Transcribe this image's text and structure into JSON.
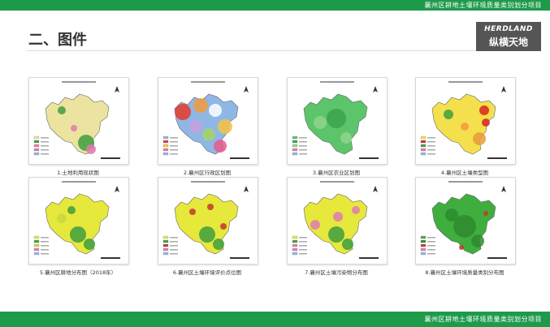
{
  "header": {
    "project_title": "襄州区耕地土壤环境质量类别划分项目"
  },
  "footer": {
    "project_title": "襄州区耕地土壤环境质量类别划分项目"
  },
  "page": {
    "title": "二、图件"
  },
  "logo": {
    "en": "HERDLAND",
    "cn": "纵横天地",
    "bg_color": "#555555"
  },
  "colors": {
    "brand_green": "#1e9a4b"
  },
  "maps": [
    {
      "caption": "1.土地利用现状图",
      "fill": "#ede3a0",
      "accent": "#3e9e3e",
      "accent2": "#e07ab0",
      "style": "landuse"
    },
    {
      "caption": "2.襄州区行政区划图",
      "fill": "#8fb7e6",
      "accent": "#e53b2c",
      "accent2": "#f6c342",
      "style": "admin"
    },
    {
      "caption": "3.襄州区农业区划图",
      "fill": "#5cc46a",
      "accent": "#3aa54c",
      "accent2": "#8fd58c",
      "style": "agri"
    },
    {
      "caption": "4.襄州区土壤类型图",
      "fill": "#f4e04d",
      "accent": "#d7261e",
      "accent2": "#3e9e3e",
      "style": "soil"
    },
    {
      "caption": "5.襄州区耕地分布图（2018年）",
      "fill": "#e6e83c",
      "accent": "#3e9e3e",
      "accent2": "#c9d840",
      "style": "farmland"
    },
    {
      "caption": "6.襄州区土壤环境评价点位图",
      "fill": "#e6e83c",
      "accent": "#3e9e3e",
      "accent2": "#c0392b",
      "style": "points"
    },
    {
      "caption": "7.襄州区土壤污染物分布图",
      "fill": "#e6e83c",
      "accent": "#3e9e3e",
      "accent2": "#e07ab0",
      "style": "pollutant"
    },
    {
      "caption": "8.襄州区土壤环境质量类别分布图",
      "fill": "#3fae3f",
      "accent": "#2e8b2e",
      "accent2": "#c0392b",
      "style": "quality"
    }
  ]
}
